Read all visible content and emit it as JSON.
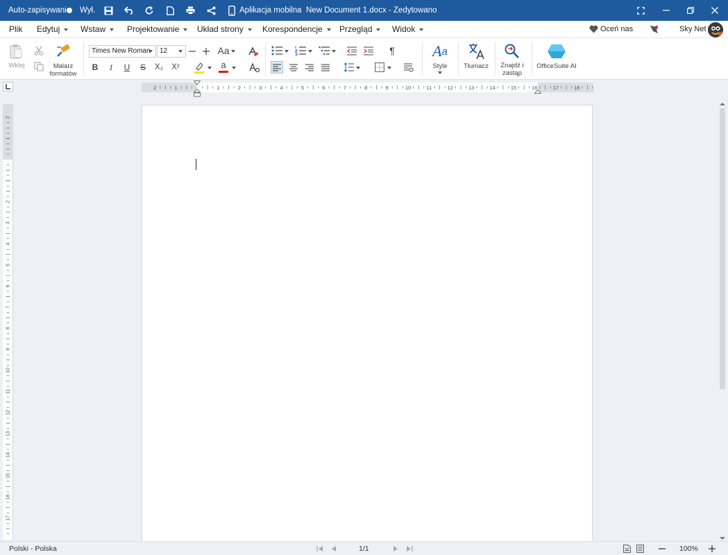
{
  "titlebar": {
    "autosave_label": "Auto-zapisywanie",
    "autosave_state": "Wył.",
    "mobile_app": "Aplikacja mobilna",
    "doc_title": "New Document 1.docx - Zedytowano"
  },
  "menu": {
    "items": [
      "Plik",
      "Edytuj",
      "Wstaw",
      "Projektowanie",
      "Układ strony",
      "Korespondencje",
      "Przegląd",
      "Widok"
    ],
    "rate": "Oceń nas",
    "user": "Sky Net"
  },
  "ribbon": {
    "paste": "Wklej",
    "format_painter": [
      "Malarz",
      "formatów"
    ],
    "font_name": "Times New Roman",
    "font_size": "12",
    "case_label": "Aa",
    "styles": "Style",
    "translator": "Tłumacz",
    "find_replace": [
      "Znajdź i",
      "zastąp"
    ],
    "ai": "OfficeSuite AI",
    "bold": "B",
    "italic": "I",
    "underline": "U",
    "strike": "S",
    "subscript": "X₂",
    "superscript": "X²",
    "font_color_letter": "a",
    "pilcrow": "¶"
  },
  "ruler": {
    "numbers": [
      "2",
      "1",
      "",
      "1",
      "2",
      "3",
      "4",
      "5",
      "6",
      "7",
      "8",
      "9",
      "10",
      "11",
      "12",
      "13",
      "14",
      "15",
      "16",
      "17",
      "18"
    ]
  },
  "vruler": {
    "numbers": [
      "2",
      "1",
      "",
      "1",
      "2",
      "3",
      "4",
      "5",
      "6",
      "7",
      "8",
      "9",
      "10",
      "11",
      "12",
      "13",
      "14",
      "15",
      "16",
      "17"
    ]
  },
  "status": {
    "language": "Polski - Polska",
    "page": "1/1",
    "zoom": "100%"
  },
  "colors": {
    "titlebar": "#1d5a9e",
    "highlight": "#f5e50b",
    "font_color": "#d42020",
    "ai_logo": "#2fa6e0"
  }
}
